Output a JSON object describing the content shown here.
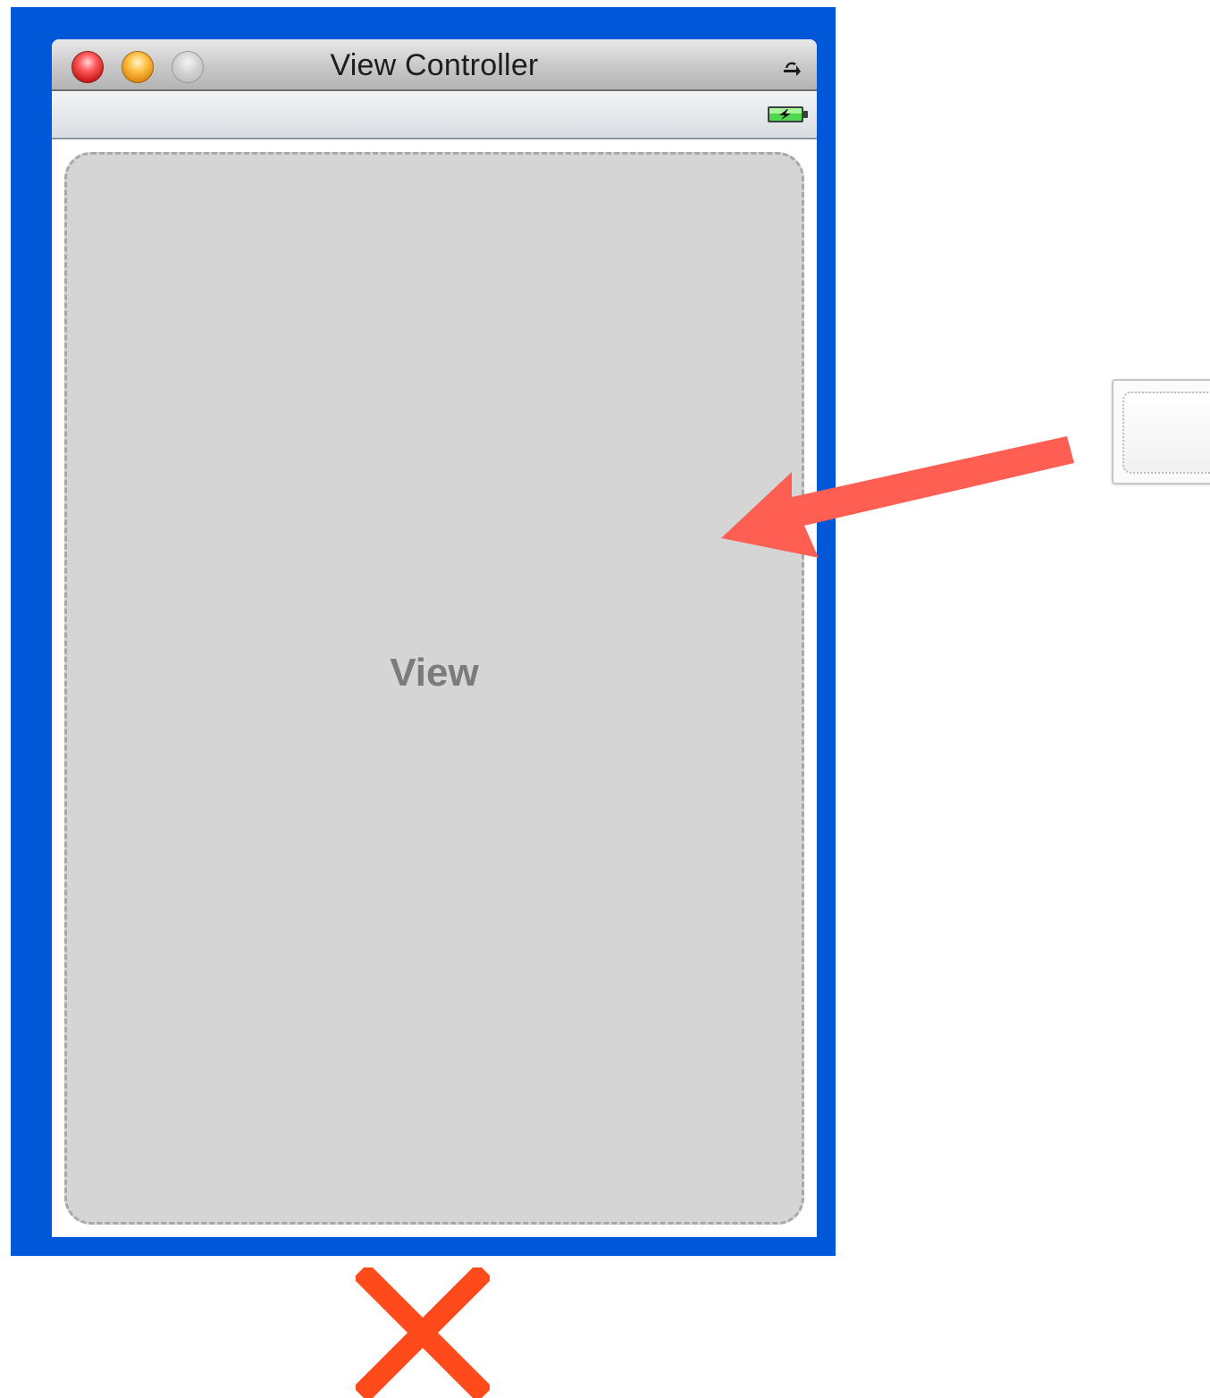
{
  "window": {
    "title": "View Controller",
    "traffic_lights": [
      "close",
      "minimize",
      "zoom"
    ],
    "title_bar_icons": [
      "rotate-icon"
    ],
    "status_bar_icons": [
      "battery-charging-icon"
    ]
  },
  "view": {
    "label": "View"
  },
  "library_item": {
    "icon": "view-object-icon"
  },
  "annotations": {
    "arrow_icon": "arrow-left-icon",
    "arrow_color": "#ff5f52",
    "cross_icon": "x-mark-icon",
    "cross_color": "#ff4a1c"
  },
  "colors": {
    "selection_border": "#0057d8",
    "view_background": "#d5d5d5",
    "view_label": "#7b7b7b"
  }
}
